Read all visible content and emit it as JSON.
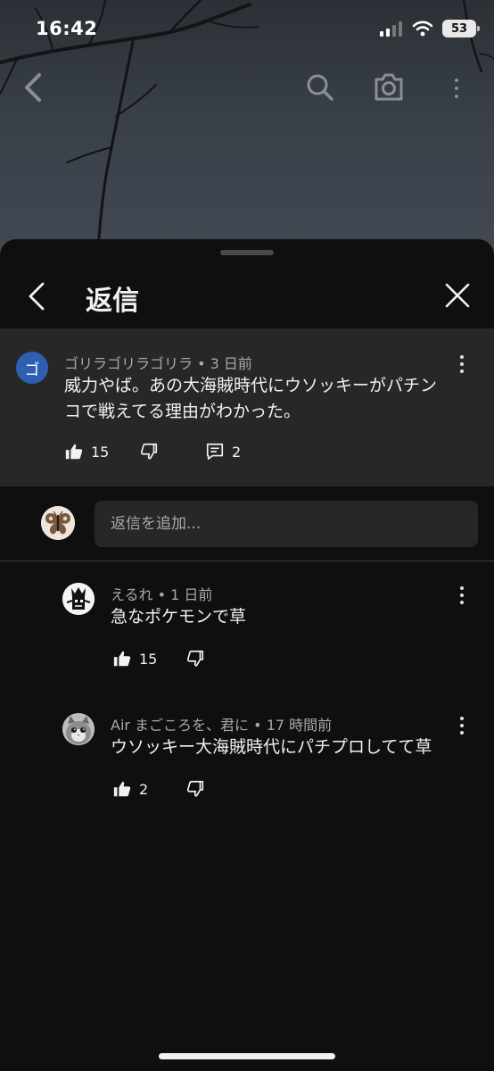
{
  "status_bar": {
    "time": "16:42",
    "battery": "53"
  },
  "sheet": {
    "title": "返信"
  },
  "parent_comment": {
    "avatar_letter": "ゴ",
    "author": "ゴリラゴリラゴリラ",
    "time": "3 日前",
    "text_line1": "威力やば。あの大海賊時代にウソッキーがパチン",
    "text_line2": "コで戦えてる理由がわかった。",
    "likes": "15",
    "replies": "2"
  },
  "add_reply": {
    "placeholder": "返信を追加..."
  },
  "replies": [
    {
      "author": "えるれ",
      "time": "1 日前",
      "text": "急なポケモンで草",
      "likes": "15"
    },
    {
      "author": "Air まごころを、君に",
      "time": "17 時間前",
      "text": "ウソッキー大海賊時代にパチプロしてて草",
      "likes": "2"
    }
  ],
  "meta_separator": "•",
  "colors": {
    "accent_avatar": "#2f5fb3",
    "sheet_bg": "#0f0f0f",
    "card_bg": "#272727"
  },
  "icons": [
    "chevron-left-icon",
    "search-icon",
    "camera-icon",
    "more-vert-icon",
    "close-icon",
    "thumb-up-icon",
    "thumb-down-icon",
    "comment-icon",
    "signal-icon",
    "wifi-icon",
    "battery-icon"
  ]
}
